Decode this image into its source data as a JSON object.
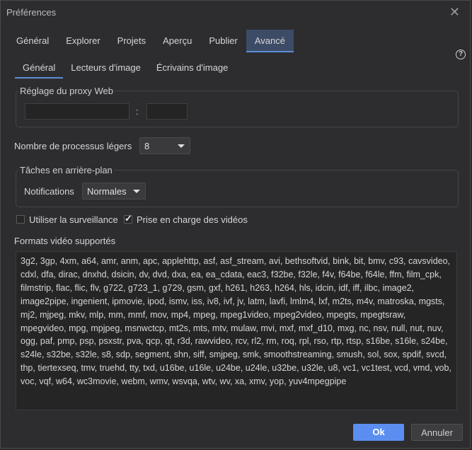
{
  "window": {
    "title": "Préférences"
  },
  "tabs": [
    {
      "label": "Général",
      "active": false
    },
    {
      "label": "Explorer",
      "active": false
    },
    {
      "label": "Projets",
      "active": false
    },
    {
      "label": "Aperçu",
      "active": false
    },
    {
      "label": "Publier",
      "active": false
    },
    {
      "label": "Avancé",
      "active": true
    }
  ],
  "help": {
    "glyph": "?"
  },
  "subtabs": [
    {
      "label": "Général",
      "active": true
    },
    {
      "label": "Lecteurs d'image",
      "active": false
    },
    {
      "label": "Écrivains d'image",
      "active": false
    }
  ],
  "proxy": {
    "title": "Réglage du proxy Web",
    "host_value": "",
    "separator": ":",
    "port_value": ""
  },
  "threads": {
    "label": "Nombre de processus légers",
    "value": "8"
  },
  "background": {
    "title": "Tâches en arrière-plan",
    "notifications_label": "Notifications",
    "notifications_value": "Normales"
  },
  "options": {
    "monitoring": {
      "label": "Utiliser la surveillance",
      "checked": false
    },
    "video_support": {
      "label": "Prise en charge des vidéos",
      "checked": true
    }
  },
  "formats": {
    "title": "Formats vidéo supportés",
    "text": "3g2, 3gp, 4xm, a64, amr, anm, apc, applehttp, asf, asf_stream, avi, bethsoftvid, bink, bit, bmv, c93, cavsvideo, cdxl, dfa, dirac, dnxhd, dsicin, dv, dvd, dxa, ea, ea_cdata, eac3, f32be, f32le, f4v, f64be, f64le, ffm, film_cpk, filmstrip, flac, flic, flv, g722, g723_1, g729, gsm, gxf, h261, h263, h264, hls, idcin, idf, iff, ilbc, image2, image2pipe, ingenient, ipmovie, ipod, ismv, iss, iv8, ivf, jv, latm, lavfi, lmlm4, lxf, m2ts, m4v, matroska, mgsts, mj2, mjpeg, mkv, mlp, mm, mmf, mov, mp4, mpeg, mpeg1video, mpeg2video, mpegts, mpegtsraw, mpegvideo, mpg, mpjpeg, msnwctcp, mt2s, mts, mtv, mulaw, mvi, mxf, mxf_d10, mxg, nc, nsv, null, nut, nuv, ogg, paf, pmp, psp, psxstr, pva, qcp, qt, r3d, rawvideo, rcv, rl2, rm, roq, rpl, rso, rtp, rtsp, s16be, s16le, s24be, s24le, s32be, s32le, s8, sdp, segment, shn, siff, smjpeg, smk, smoothstreaming, smush, sol, sox, spdif, svcd, thp, tiertexseq, tmv, truehd, tty, txd, u16be, u16le, u24be, u24le, u32be, u32le, u8, vc1, vc1test, vcd, vmd, vob, voc, vqf, w64, wc3movie, webm, wmv, wsvqa, wtv, wv, xa, xmv, yop, yuv4mpegpipe"
  },
  "buttons": {
    "ok": "Ok",
    "cancel": "Annuler"
  },
  "colors": {
    "accent": "#5b8ef0",
    "background": "#2d2d30",
    "active_tab": "#3d4c66"
  }
}
